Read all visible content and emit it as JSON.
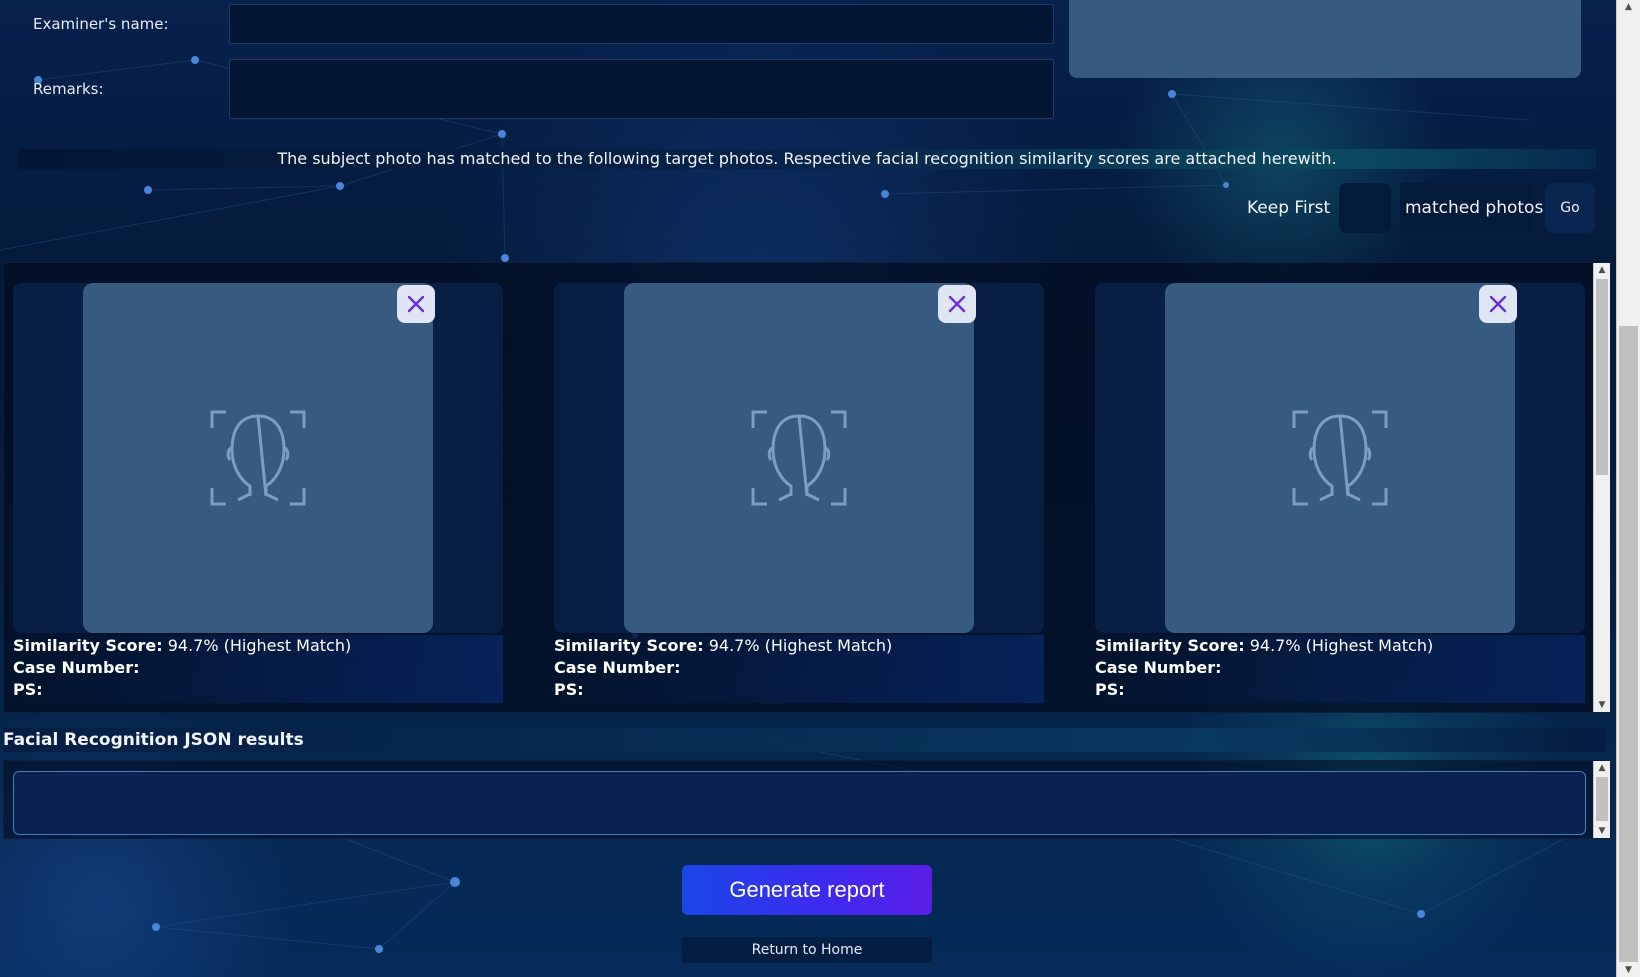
{
  "form": {
    "examiner_label": "Examiner's name:",
    "examiner_value": "",
    "remarks_label": "Remarks:",
    "remarks_value": ""
  },
  "match_message": "The subject photo has matched to the following target photos. Respective facial recognition similarity scores are attached herewith.",
  "keep": {
    "prefix": "Keep First",
    "value": "",
    "suffix": "matched photos",
    "go_label": "Go"
  },
  "matches": [
    {
      "score_label": "Similarity Score:",
      "score_value": "94.7% (Highest Match)",
      "case_label": "Case Number:",
      "case_value": "",
      "ps_label": "PS:",
      "ps_value": "",
      "photo_icon": "face-scan-icon",
      "remove_icon": "close-icon"
    },
    {
      "score_label": "Similarity Score:",
      "score_value": "94.7% (Highest Match)",
      "case_label": "Case Number:",
      "case_value": "",
      "ps_label": "PS:",
      "ps_value": "",
      "photo_icon": "face-scan-icon",
      "remove_icon": "close-icon"
    },
    {
      "score_label": "Similarity Score:",
      "score_value": "94.7% (Highest Match)",
      "case_label": "Case Number:",
      "case_value": "",
      "ps_label": "PS:",
      "ps_value": "",
      "photo_icon": "face-scan-icon",
      "remove_icon": "close-icon"
    }
  ],
  "json_section": {
    "heading": "Facial Recognition JSON results",
    "value": ""
  },
  "actions": {
    "generate_label": "Generate report",
    "home_label": "Return to Home"
  },
  "colors": {
    "accent_gradient_start": "#1a47e6",
    "accent_gradient_end": "#5b1ee8",
    "remove_icon": "#6a2ed6",
    "placeholder_photo": "#365a80",
    "background": "#041937"
  }
}
